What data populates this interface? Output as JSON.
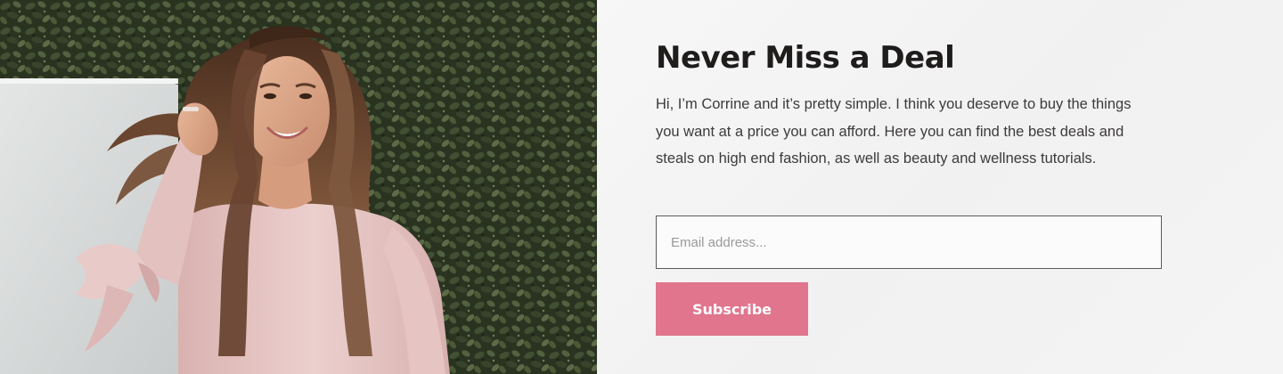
{
  "newsletter": {
    "title": "Never Miss a Deal",
    "intro": "Hi, I’m Corrine and it’s pretty simple. I think you deserve to buy the things you want at a price you can afford. Here you can find the best deals and steals on high end fashion, as well as beauty and wellness tutorials.",
    "email_placeholder": "Email address...",
    "email_value": "",
    "subscribe_label": "Subscribe"
  },
  "colors": {
    "accent": "#e0758d",
    "title": "#1f1c1c",
    "body_text": "#3d3a3a",
    "panel_bg": "#f4f4f4",
    "foliage": "#2f3a26",
    "top_pink": "#e6c6c6"
  }
}
